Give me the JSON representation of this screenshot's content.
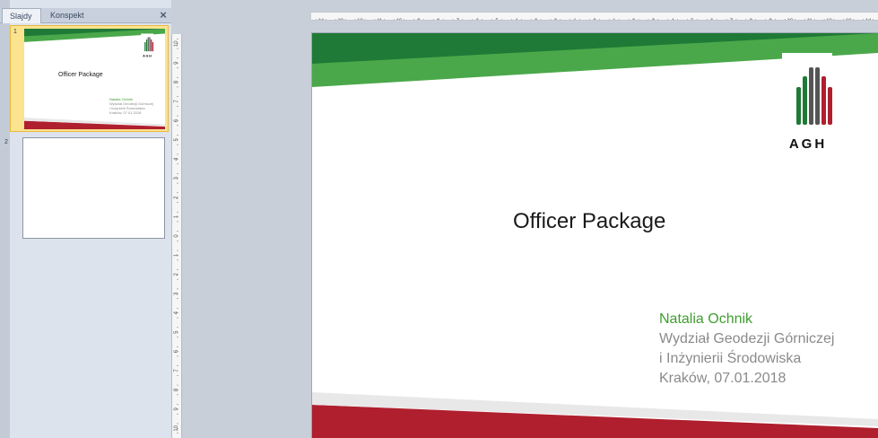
{
  "pane": {
    "tabs": [
      {
        "label": "Slajdy",
        "active": true
      },
      {
        "label": "Konspekt",
        "active": false
      }
    ],
    "close_symbol": "×"
  },
  "thumbnails": [
    {
      "number": "1",
      "selected": true
    },
    {
      "number": "2",
      "selected": false
    }
  ],
  "slide": {
    "title": "Officer Package",
    "author": "Natalia Ochnik",
    "lines": [
      "Wydział Geodezji Górniczej",
      "i Inżynierii Środowiska",
      "Kraków, 07.01.2018"
    ],
    "logo_text": "AGH"
  },
  "rulers": {
    "horizontal_labels": [
      "14",
      "13",
      "12",
      "11",
      "10",
      "9",
      "8",
      "7",
      "6",
      "5",
      "4",
      "3",
      "2",
      "1",
      "0",
      "1",
      "2",
      "3",
      "4",
      "5",
      "6",
      "7",
      "8",
      "9",
      "10",
      "11",
      "12",
      "13",
      "14"
    ],
    "vertical_labels": [
      "10",
      "9",
      "8",
      "7",
      "6",
      "5",
      "4",
      "3",
      "2",
      "1",
      "0",
      "1",
      "2",
      "3",
      "4",
      "5",
      "6",
      "7",
      "8",
      "9",
      "10"
    ]
  },
  "colors": {
    "dark_green": "#1e7a36",
    "light_green": "#4aa84a",
    "red": "#b01f2e",
    "author_green": "#3f9e2f",
    "gray_text": "#8a8a8a"
  }
}
